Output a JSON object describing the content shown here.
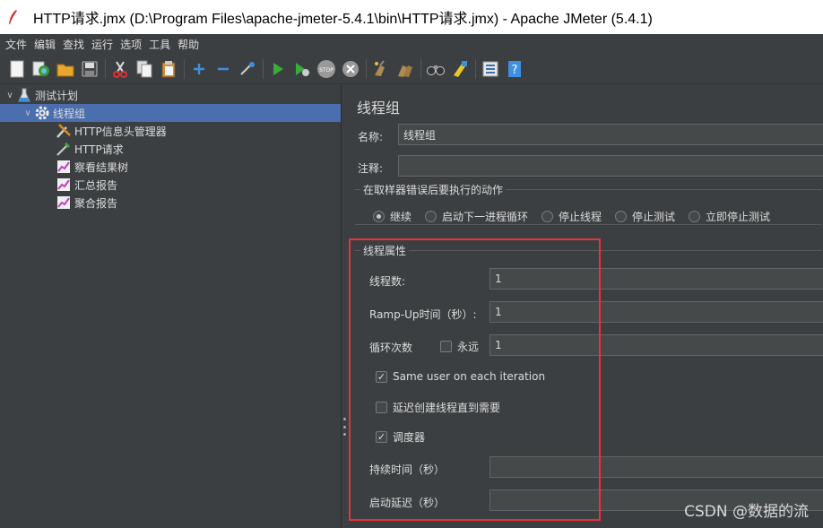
{
  "window": {
    "title": "HTTP请求.jmx (D:\\Program Files\\apache-jmeter-5.4.1\\bin\\HTTP请求.jmx) - Apache JMeter (5.4.1)"
  },
  "menu": [
    "文件",
    "编辑",
    "查找",
    "运行",
    "选项",
    "工具",
    "帮助"
  ],
  "toolbar": {
    "icons": [
      "new-icon",
      "templates-icon",
      "open-icon",
      "save-icon",
      "cut-icon",
      "copy-icon",
      "paste-icon",
      "expand-icon",
      "collapse-icon",
      "toggle-icon",
      "start-icon",
      "start-no-pause-icon",
      "stop-icon",
      "shutdown-icon",
      "clear-icon",
      "clear-all-icon",
      "search-icon",
      "reset-search-icon",
      "function-helper-icon",
      "help-icon"
    ]
  },
  "tree": {
    "items": [
      {
        "label": "测试计划",
        "icon": "flask-icon",
        "level": 0,
        "expanded": true
      },
      {
        "label": "线程组",
        "icon": "gear-icon",
        "level": 1,
        "expanded": true,
        "selected": true
      },
      {
        "label": "HTTP信息头管理器",
        "icon": "wrench-icon",
        "level": 2
      },
      {
        "label": "HTTP请求",
        "icon": "pipette-icon",
        "level": 2
      },
      {
        "label": "察看结果树",
        "icon": "chart-icon",
        "level": 2
      },
      {
        "label": "汇总报告",
        "icon": "chart-icon",
        "level": 2
      },
      {
        "label": "聚合报告",
        "icon": "chart-icon",
        "level": 2
      }
    ]
  },
  "form": {
    "title": "线程组",
    "name_label": "名称:",
    "name_value": "线程组",
    "comment_label": "注释:",
    "comment_value": "",
    "error_action": {
      "title": "在取样器错误后要执行的动作",
      "options": [
        "继续",
        "启动下一进程循环",
        "停止线程",
        "停止测试",
        "立即停止测试"
      ],
      "selected": "继续"
    },
    "thread_props": {
      "title": "线程属性",
      "threads_label": "线程数:",
      "threads_value": "1",
      "rampup_label": "Ramp-Up时间（秒）:",
      "rampup_value": "1",
      "loop_label": "循环次数",
      "forever_label": "永远",
      "forever_checked": false,
      "loop_value": "1",
      "same_user_label": "Same user on each iteration",
      "same_user_checked": true,
      "delay_create_label": "延迟创建线程直到需要",
      "delay_create_checked": false,
      "scheduler_label": "调度器",
      "scheduler_checked": true,
      "duration_label": "持续时间（秒）",
      "duration_value": "",
      "startup_delay_label": "启动延迟（秒）",
      "startup_delay_value": ""
    }
  },
  "watermark": "CSDN @数据的流"
}
